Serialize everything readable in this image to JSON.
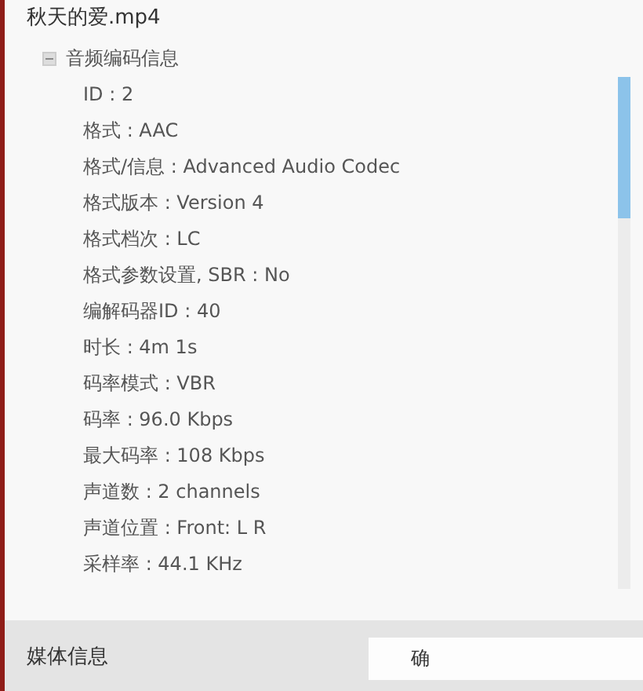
{
  "window": {
    "title": "秋天的爱.mp4"
  },
  "tree": [
    {
      "label": "音频编码信息",
      "expanded": true,
      "children": [
        {
          "label": "ID : 2"
        },
        {
          "label": "格式 : AAC"
        },
        {
          "label": "格式/信息 : Advanced Audio Codec"
        },
        {
          "label": "格式版本 : Version 4"
        },
        {
          "label": "格式档次 : LC"
        },
        {
          "label": "格式参数设置, SBR : No"
        },
        {
          "label": "编解码器ID : 40"
        },
        {
          "label": "时长 : 4m 1s"
        },
        {
          "label": "码率模式 : VBR"
        },
        {
          "label": "码率 : 96.0 Kbps"
        },
        {
          "label": "最大码率 : 108 Kbps"
        },
        {
          "label": "声道数 : 2 channels"
        },
        {
          "label": "声道位置 : Front: L R"
        },
        {
          "label": "采样率 : 44.1 KHz"
        }
      ]
    }
  ],
  "footer": {
    "title": "媒体信息",
    "button": "确"
  }
}
